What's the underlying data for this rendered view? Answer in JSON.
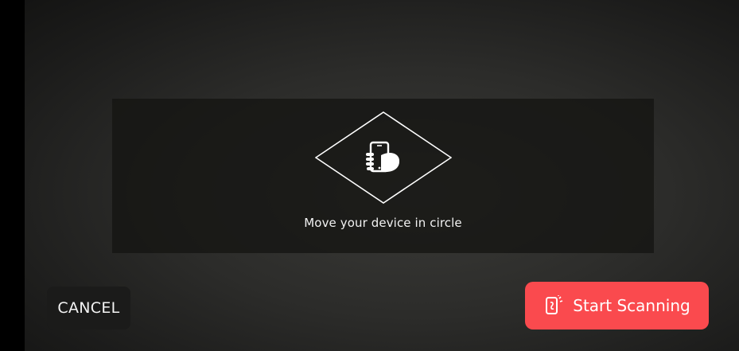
{
  "guide": {
    "instruction": "Move your device in circle",
    "icon": "phone-in-hand-icon"
  },
  "actions": {
    "cancel_label": "CANCEL",
    "start_label": "Start Scanning",
    "start_icon": "phone-scan-icon"
  },
  "colors": {
    "accent": "#fa4a4e",
    "panel": "#141412",
    "text": "#f2f2f2"
  }
}
